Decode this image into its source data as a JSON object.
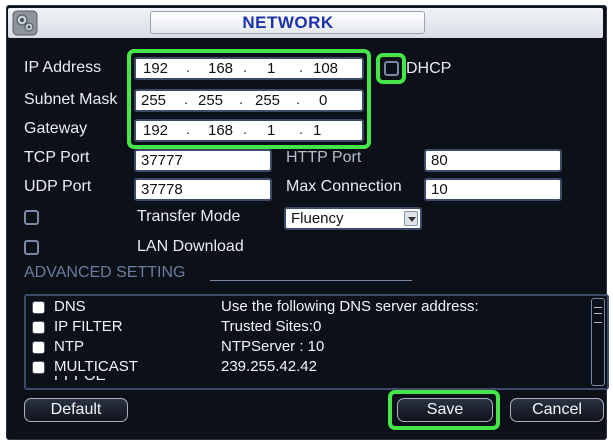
{
  "window": {
    "title": "NETWORK",
    "icon": "network-settings-icon"
  },
  "form": {
    "ip_address": {
      "label": "IP Address",
      "octets": [
        "192",
        "168",
        "1",
        "108"
      ]
    },
    "dhcp": {
      "label": "DHCP",
      "checked": false
    },
    "subnet_mask": {
      "label": "Subnet Mask",
      "octets": [
        "255",
        "255",
        "255",
        "0"
      ]
    },
    "gateway": {
      "label": "Gateway",
      "octets": [
        "192",
        "168",
        "1",
        "1"
      ]
    },
    "tcp_port": {
      "label": "TCP Port",
      "value": "37777"
    },
    "http_port": {
      "label": "HTTP Port",
      "value": "80"
    },
    "udp_port": {
      "label": "UDP Port",
      "value": "37778"
    },
    "max_connection": {
      "label": "Max Connection",
      "value": "10"
    },
    "transfer_mode": {
      "label": "Transfer Mode",
      "value": "Fluency",
      "checked": false
    },
    "lan_download": {
      "label": "LAN Download",
      "checked": false
    }
  },
  "advanced": {
    "heading": "ADVANCED SETTING",
    "items": [
      {
        "name": "DNS",
        "desc": "Use the following DNS server address:"
      },
      {
        "name": "IP FILTER",
        "desc": "Trusted Sites:0"
      },
      {
        "name": "NTP",
        "desc": "NTPServer : 10"
      },
      {
        "name": "MULTICAST",
        "desc": "239.255.42.42"
      },
      {
        "name": "PPPOE",
        "desc": ""
      }
    ]
  },
  "buttons": {
    "default": "Default",
    "save": "Save",
    "cancel": "Cancel"
  },
  "colors": {
    "highlight": "#46e64a",
    "title_text": "#1f33a8",
    "panel_bg": "#0c1018"
  }
}
